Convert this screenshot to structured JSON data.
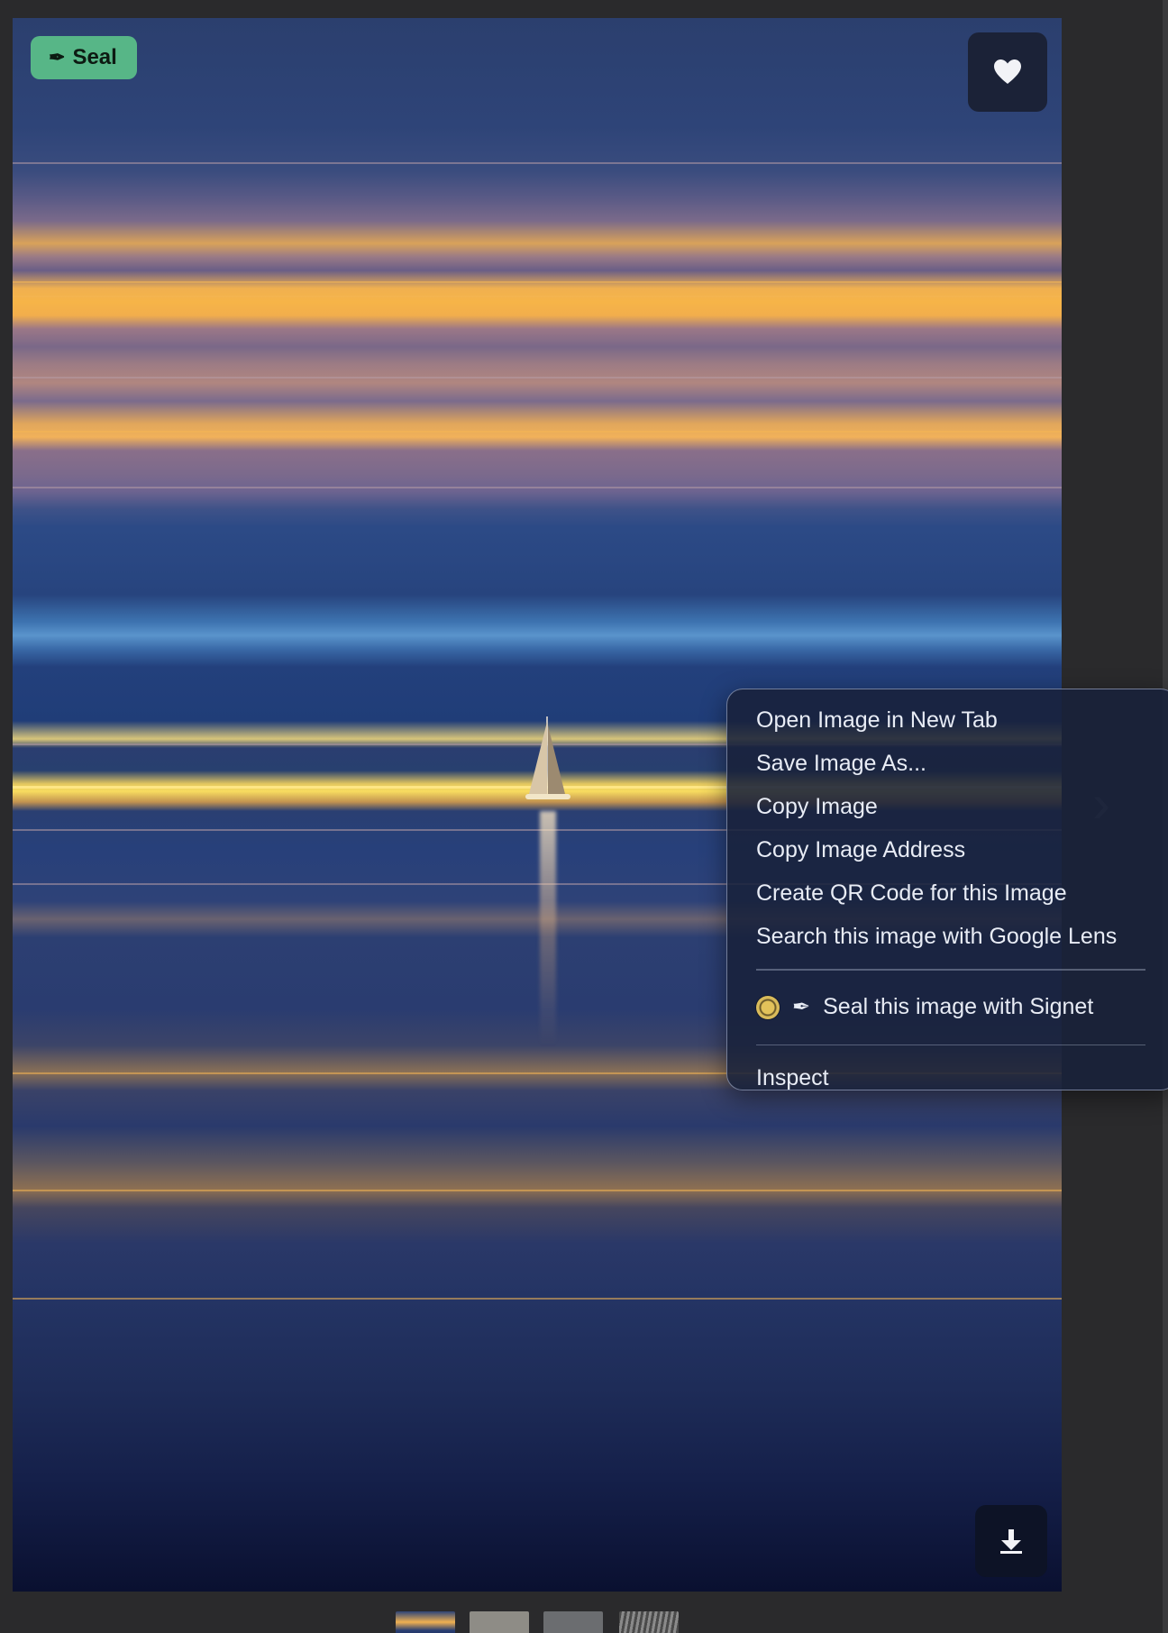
{
  "seal_badge": {
    "icon": "fountain-pen-icon",
    "label": "Seal"
  },
  "favorite_button": {
    "icon": "heart-icon"
  },
  "download_button": {
    "icon": "download-icon"
  },
  "context_menu": {
    "items": [
      {
        "label": "Open Image in New Tab"
      },
      {
        "label": "Save Image As..."
      },
      {
        "label": "Copy Image"
      },
      {
        "label": "Copy Image Address"
      },
      {
        "label": "Create QR Code for this Image"
      },
      {
        "label": "Search this image with Google Lens"
      }
    ],
    "signet_item": {
      "label": "Seal this image with Signet",
      "icons": [
        "signet-coin-icon",
        "fountain-pen-icon"
      ]
    },
    "inspect_item": {
      "label": "Inspect"
    }
  },
  "thumbnails": [
    {
      "name": "thumbnail-1",
      "selected": true
    },
    {
      "name": "thumbnail-2",
      "selected": false
    },
    {
      "name": "thumbnail-3",
      "selected": false
    },
    {
      "name": "thumbnail-4",
      "selected": false
    }
  ],
  "colors": {
    "seal_badge_bg": "#57b687",
    "menu_bg": "#18213a",
    "menu_text": "#e8ecf5"
  }
}
